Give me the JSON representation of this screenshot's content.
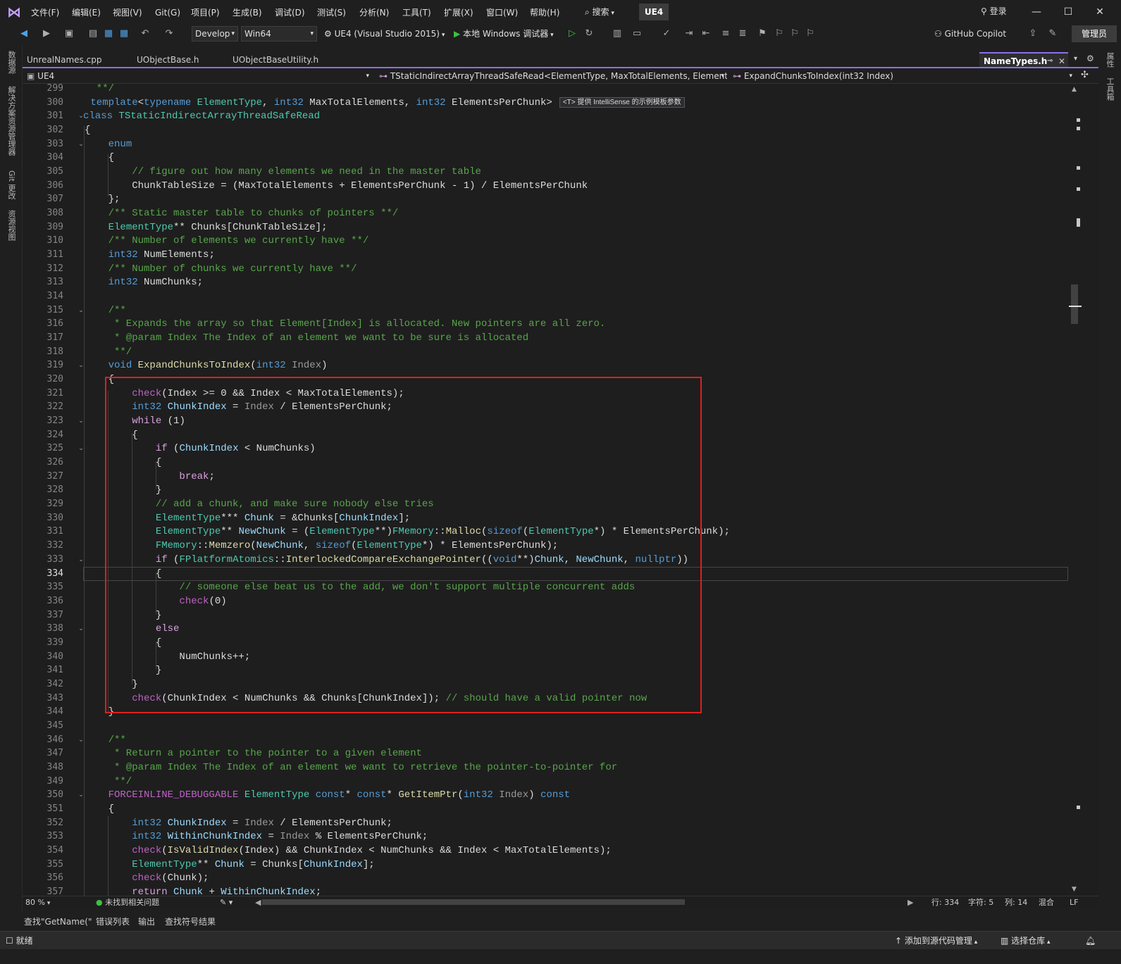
{
  "menubar": {
    "items": [
      "文件(F)",
      "编辑(E)",
      "视图(V)",
      "Git(G)",
      "项目(P)",
      "生成(B)",
      "调试(D)",
      "测试(S)",
      "分析(N)",
      "工具(T)",
      "扩展(X)",
      "窗口(W)",
      "帮助(H)"
    ],
    "search_label": "搜索",
    "solution_name": "UE4",
    "login_label": "登录"
  },
  "toolbar": {
    "configuration": "Develop",
    "platform": "Win64",
    "startup_project": "UE4 (Visual Studio 2015)",
    "debugger": "本地 Windows 调试器",
    "copilot_label": "GitHub Copilot",
    "admin_label": "管理员"
  },
  "left_panels": [
    "数据源",
    "解决方案资源管理器",
    "Git 更改",
    "资源视图"
  ],
  "right_panels": [
    "属性",
    "工具箱"
  ],
  "tabs": {
    "inactive": [
      "UnrealNames.cpp",
      "UObjectBase.h",
      "UObjectBaseUtility.h"
    ],
    "active": "NameTypes.h"
  },
  "navbar": {
    "project": "UE4",
    "scope": "TStaticIndirectArrayThreadSafeRead<ElementType, MaxTotalElements, Elements",
    "member": "ExpandChunksToIndex(int32 Index)"
  },
  "editor": {
    "first_line": 299,
    "current_line": 334,
    "intellisense_hint": "<T> 提供 IntelliSense 的示例模板参数"
  },
  "editor_status": {
    "zoom": "80 %",
    "issues": "未找到相关问题",
    "line": "行: 334",
    "char": "字符: 5",
    "col": "列: 14",
    "indent": "混合",
    "eol": "LF"
  },
  "panel_tabs": [
    "查找\"GetName(\"",
    "错误列表",
    "输出",
    "查找符号结果"
  ],
  "statusbar": {
    "ready": "就绪",
    "add_source_control": "添加到源代码管理",
    "select_repo": "选择仓库"
  },
  "colors": {
    "accent": "#8d6ee8",
    "highlight_box": "#e01e1e"
  }
}
